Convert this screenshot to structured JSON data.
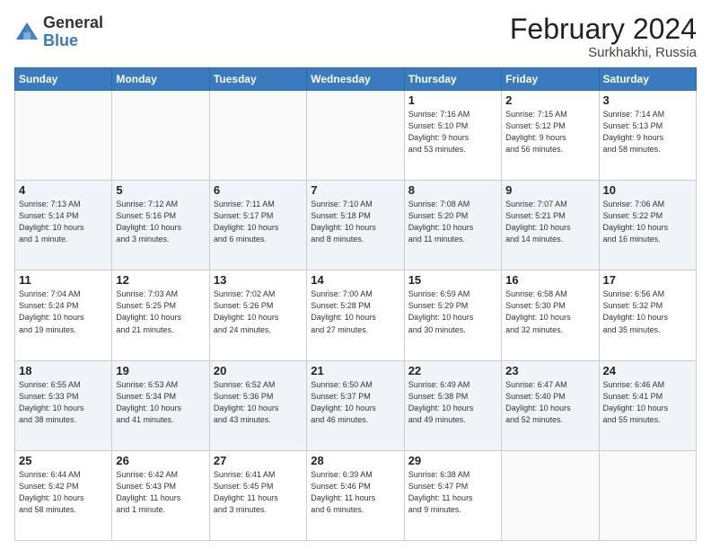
{
  "header": {
    "logo_general": "General",
    "logo_blue": "Blue",
    "title": "February 2024",
    "location": "Surkhakhi, Russia"
  },
  "days_of_week": [
    "Sunday",
    "Monday",
    "Tuesday",
    "Wednesday",
    "Thursday",
    "Friday",
    "Saturday"
  ],
  "rows": [
    [
      {
        "day": "",
        "info": "",
        "empty": true
      },
      {
        "day": "",
        "info": "",
        "empty": true
      },
      {
        "day": "",
        "info": "",
        "empty": true
      },
      {
        "day": "",
        "info": "",
        "empty": true
      },
      {
        "day": "1",
        "info": "Sunrise: 7:16 AM\nSunset: 5:10 PM\nDaylight: 9 hours\nand 53 minutes."
      },
      {
        "day": "2",
        "info": "Sunrise: 7:15 AM\nSunset: 5:12 PM\nDaylight: 9 hours\nand 56 minutes."
      },
      {
        "day": "3",
        "info": "Sunrise: 7:14 AM\nSunset: 5:13 PM\nDaylight: 9 hours\nand 58 minutes."
      }
    ],
    [
      {
        "day": "4",
        "info": "Sunrise: 7:13 AM\nSunset: 5:14 PM\nDaylight: 10 hours\nand 1 minute."
      },
      {
        "day": "5",
        "info": "Sunrise: 7:12 AM\nSunset: 5:16 PM\nDaylight: 10 hours\nand 3 minutes."
      },
      {
        "day": "6",
        "info": "Sunrise: 7:11 AM\nSunset: 5:17 PM\nDaylight: 10 hours\nand 6 minutes."
      },
      {
        "day": "7",
        "info": "Sunrise: 7:10 AM\nSunset: 5:18 PM\nDaylight: 10 hours\nand 8 minutes."
      },
      {
        "day": "8",
        "info": "Sunrise: 7:08 AM\nSunset: 5:20 PM\nDaylight: 10 hours\nand 11 minutes."
      },
      {
        "day": "9",
        "info": "Sunrise: 7:07 AM\nSunset: 5:21 PM\nDaylight: 10 hours\nand 14 minutes."
      },
      {
        "day": "10",
        "info": "Sunrise: 7:06 AM\nSunset: 5:22 PM\nDaylight: 10 hours\nand 16 minutes."
      }
    ],
    [
      {
        "day": "11",
        "info": "Sunrise: 7:04 AM\nSunset: 5:24 PM\nDaylight: 10 hours\nand 19 minutes."
      },
      {
        "day": "12",
        "info": "Sunrise: 7:03 AM\nSunset: 5:25 PM\nDaylight: 10 hours\nand 21 minutes."
      },
      {
        "day": "13",
        "info": "Sunrise: 7:02 AM\nSunset: 5:26 PM\nDaylight: 10 hours\nand 24 minutes."
      },
      {
        "day": "14",
        "info": "Sunrise: 7:00 AM\nSunset: 5:28 PM\nDaylight: 10 hours\nand 27 minutes."
      },
      {
        "day": "15",
        "info": "Sunrise: 6:59 AM\nSunset: 5:29 PM\nDaylight: 10 hours\nand 30 minutes."
      },
      {
        "day": "16",
        "info": "Sunrise: 6:58 AM\nSunset: 5:30 PM\nDaylight: 10 hours\nand 32 minutes."
      },
      {
        "day": "17",
        "info": "Sunrise: 6:56 AM\nSunset: 5:32 PM\nDaylight: 10 hours\nand 35 minutes."
      }
    ],
    [
      {
        "day": "18",
        "info": "Sunrise: 6:55 AM\nSunset: 5:33 PM\nDaylight: 10 hours\nand 38 minutes."
      },
      {
        "day": "19",
        "info": "Sunrise: 6:53 AM\nSunset: 5:34 PM\nDaylight: 10 hours\nand 41 minutes."
      },
      {
        "day": "20",
        "info": "Sunrise: 6:52 AM\nSunset: 5:36 PM\nDaylight: 10 hours\nand 43 minutes."
      },
      {
        "day": "21",
        "info": "Sunrise: 6:50 AM\nSunset: 5:37 PM\nDaylight: 10 hours\nand 46 minutes."
      },
      {
        "day": "22",
        "info": "Sunrise: 6:49 AM\nSunset: 5:38 PM\nDaylight: 10 hours\nand 49 minutes."
      },
      {
        "day": "23",
        "info": "Sunrise: 6:47 AM\nSunset: 5:40 PM\nDaylight: 10 hours\nand 52 minutes."
      },
      {
        "day": "24",
        "info": "Sunrise: 6:46 AM\nSunset: 5:41 PM\nDaylight: 10 hours\nand 55 minutes."
      }
    ],
    [
      {
        "day": "25",
        "info": "Sunrise: 6:44 AM\nSunset: 5:42 PM\nDaylight: 10 hours\nand 58 minutes."
      },
      {
        "day": "26",
        "info": "Sunrise: 6:42 AM\nSunset: 5:43 PM\nDaylight: 11 hours\nand 1 minute."
      },
      {
        "day": "27",
        "info": "Sunrise: 6:41 AM\nSunset: 5:45 PM\nDaylight: 11 hours\nand 3 minutes."
      },
      {
        "day": "28",
        "info": "Sunrise: 6:39 AM\nSunset: 5:46 PM\nDaylight: 11 hours\nand 6 minutes."
      },
      {
        "day": "29",
        "info": "Sunrise: 6:38 AM\nSunset: 5:47 PM\nDaylight: 11 hours\nand 9 minutes."
      },
      {
        "day": "",
        "info": "",
        "empty": true
      },
      {
        "day": "",
        "info": "",
        "empty": true
      }
    ]
  ]
}
